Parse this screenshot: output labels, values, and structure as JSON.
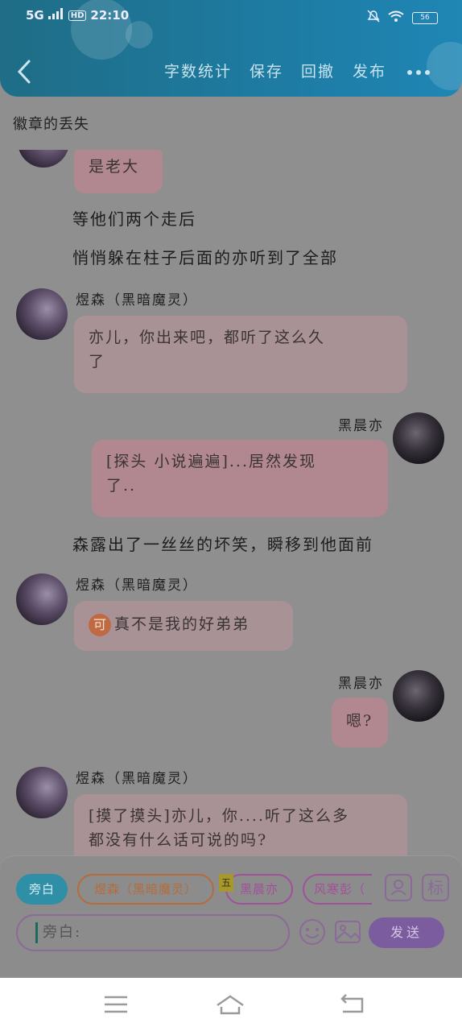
{
  "status_bar": {
    "network": "5G",
    "hd": "HD",
    "time": "22:10",
    "battery": "56"
  },
  "header": {
    "menu": [
      "字数统计",
      "保存",
      "回撤",
      "发布"
    ]
  },
  "doc_title": "徽章的丢失",
  "chat": {
    "top_bubble": "是老大",
    "narration_1": "等他们两个走后",
    "narration_2": "悄悄躲在柱子后面的亦听到了全部",
    "msg1": {
      "name": "煜森（黑暗魔灵）",
      "text_line1": "亦儿，你出来吧，都听了这么久",
      "text_line2": "了"
    },
    "msg2": {
      "name": "黑晨亦",
      "text_line1": "[探头 小说遍遍]...居然发现",
      "text_line2": "了.."
    },
    "narration_3": "森露出了一丝丝的坏笑，瞬移到他面前",
    "msg3": {
      "name": "煜森（黑暗魔灵）",
      "badge": "可",
      "text": "真不是我的好弟弟"
    },
    "msg4": {
      "name": "黑晨亦",
      "text": "嗯?"
    },
    "msg5": {
      "name": "煜森（黑暗魔灵）",
      "text_line1": "[摸了摸头]亦儿，你....听了这么多",
      "text_line2": "都没有什么话可说的吗?"
    }
  },
  "input_panel": {
    "chips": [
      "旁白",
      "煜森（黑暗魔灵）",
      "黑晨亦",
      "风寒彭（"
    ],
    "tag": "五",
    "mark_button": "标",
    "input_text": "旁白:",
    "send_label": "发送"
  }
}
